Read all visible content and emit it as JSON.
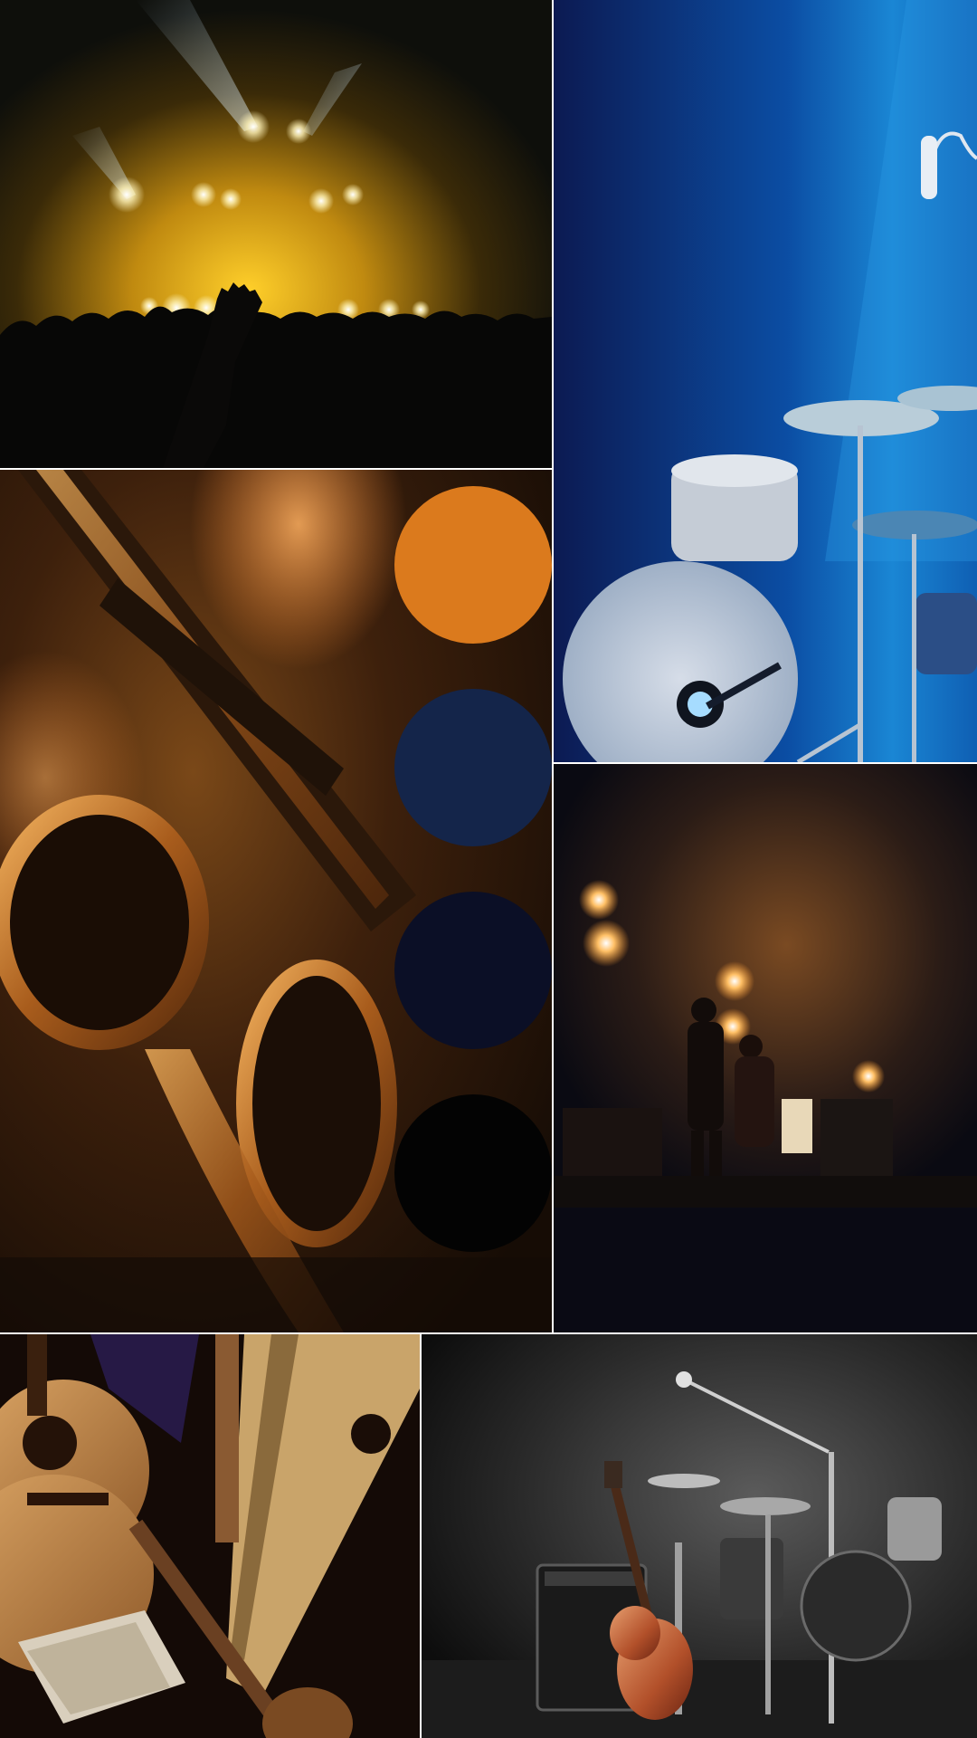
{
  "photos": [
    {
      "name": "concert-crowd-photo"
    },
    {
      "name": "blue-drum-kit-photo"
    },
    {
      "name": "saxophone-photo"
    },
    {
      "name": "band-on-stage-photo"
    },
    {
      "name": "acoustic-instruments-photo"
    },
    {
      "name": "monochrome-drum-kit-guitar-photo"
    }
  ],
  "palette": {
    "swatches": [
      "#DB7A1D",
      "#14254A",
      "#0B0F26",
      "#030303"
    ]
  }
}
